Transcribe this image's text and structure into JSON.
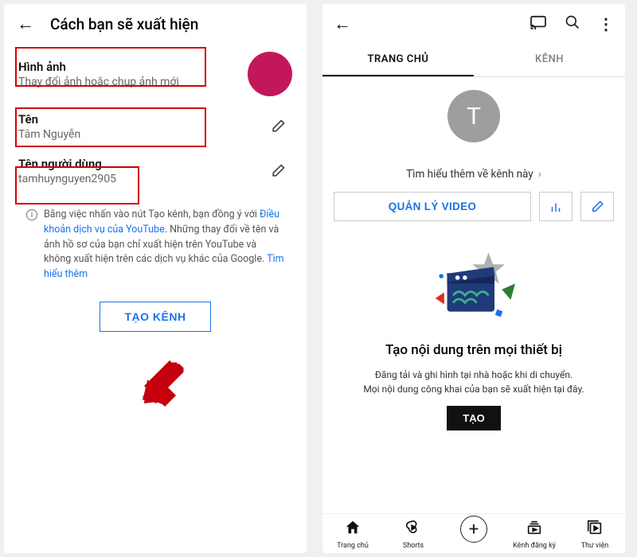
{
  "left": {
    "title": "Cách bạn sẽ xuất hiện",
    "rows": {
      "image": {
        "label": "Hình ảnh",
        "value": "Thay đổi ảnh hoặc chụp ảnh mới"
      },
      "name": {
        "label": "Tên",
        "value": "Tâm Nguyễn"
      },
      "handle": {
        "label": "Tên người dùng",
        "value": "tamhuynguyen2905"
      }
    },
    "terms": {
      "pre": "Bằng việc nhấn vào nút Tạo kênh, bạn đồng ý với ",
      "link1": "Điều khoản dịch vụ của YouTube",
      "mid": ". Những thay đổi về tên và ảnh hồ sơ của bạn chỉ xuất hiện trên YouTube và không xuất hiện trên các dịch vụ khác của Google. ",
      "link2": "Tìm hiểu thêm"
    },
    "create_btn": "TẠO KÊNH"
  },
  "right": {
    "tabs": {
      "home": "TRANG CHỦ",
      "channel": "KÊNH"
    },
    "avatar_letter": "T",
    "learn_more": "Tìm hiểu thêm về kênh này",
    "manage_btn": "QUẢN LÝ VIDEO",
    "promo": {
      "title": "Tạo nội dung trên mọi thiết bị",
      "sub1": "Đăng tải và ghi hình tại nhà hoặc khi di chuyển.",
      "sub2": "Mọi nội dung công khai của bạn sẽ xuất hiện tại đây.",
      "btn": "TẠO"
    },
    "nav": {
      "home": "Trang chủ",
      "shorts": "Shorts",
      "subs": "Kênh đăng ký",
      "library": "Thư viện"
    }
  }
}
